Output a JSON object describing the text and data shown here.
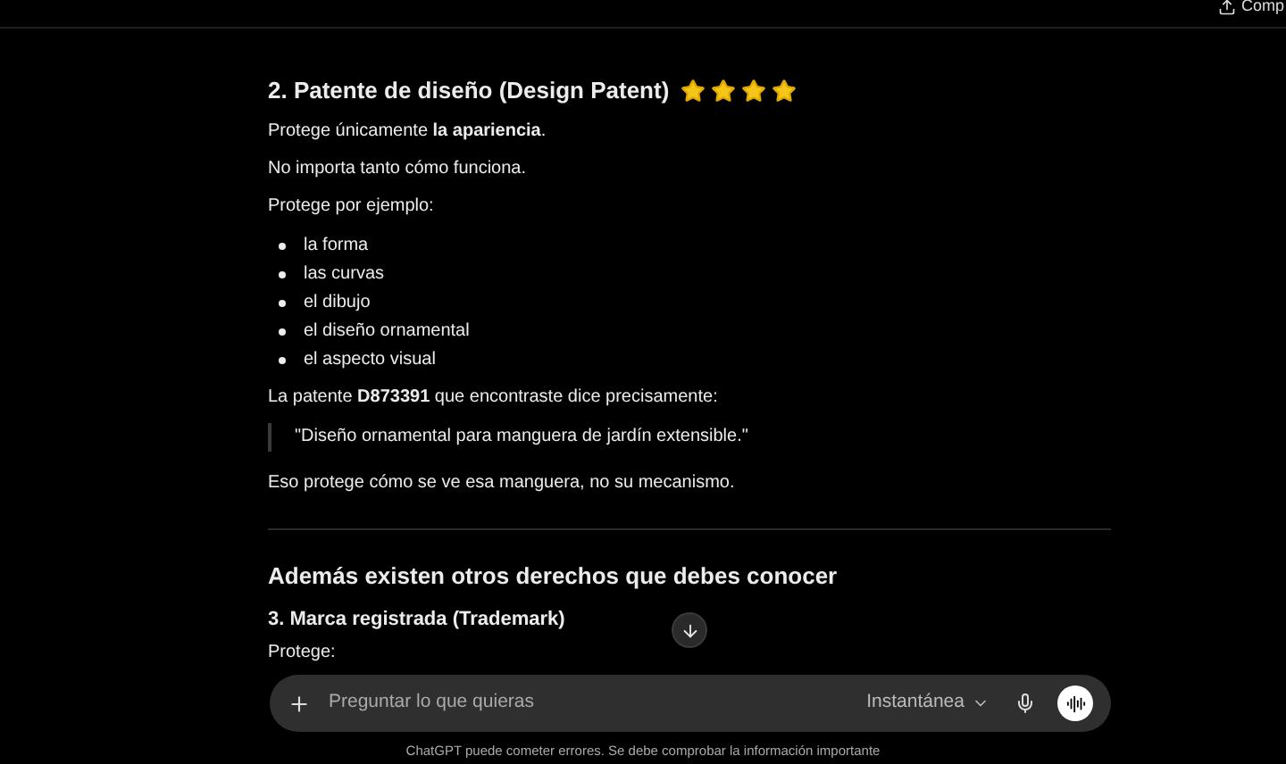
{
  "top_bar": {
    "share_label": "Comp"
  },
  "heading": {
    "text": "2. Patente de diseño (Design Patent)",
    "stars": 4
  },
  "paragraphs_1": [
    "Protege únicamente **la apariencia**.",
    "No importa tanto cómo funciona.",
    "Protege por ejemplo:"
  ],
  "list": [
    "la forma",
    "las curvas",
    "el dibujo",
    "el diseño ornamental",
    "el aspecto visual"
  ],
  "intro": "La patente **D873391** que encontraste dice precisamente:",
  "quote": "\"Diseño ornamental para manguera de jardín extensible.\"",
  "conclusion": "Eso protege cómo se ve esa manguera, no su mecanismo.",
  "section_heading": "Además existen otros derechos que debes conocer",
  "subheading": "3. Marca registrada (Trademark)",
  "partial_text": "Protege:",
  "composer": {
    "placeholder": "Preguntar lo que quieras",
    "model": "Instantánea"
  },
  "footer": "ChatGPT puede cometer errores. Se debe comprobar la información importante"
}
